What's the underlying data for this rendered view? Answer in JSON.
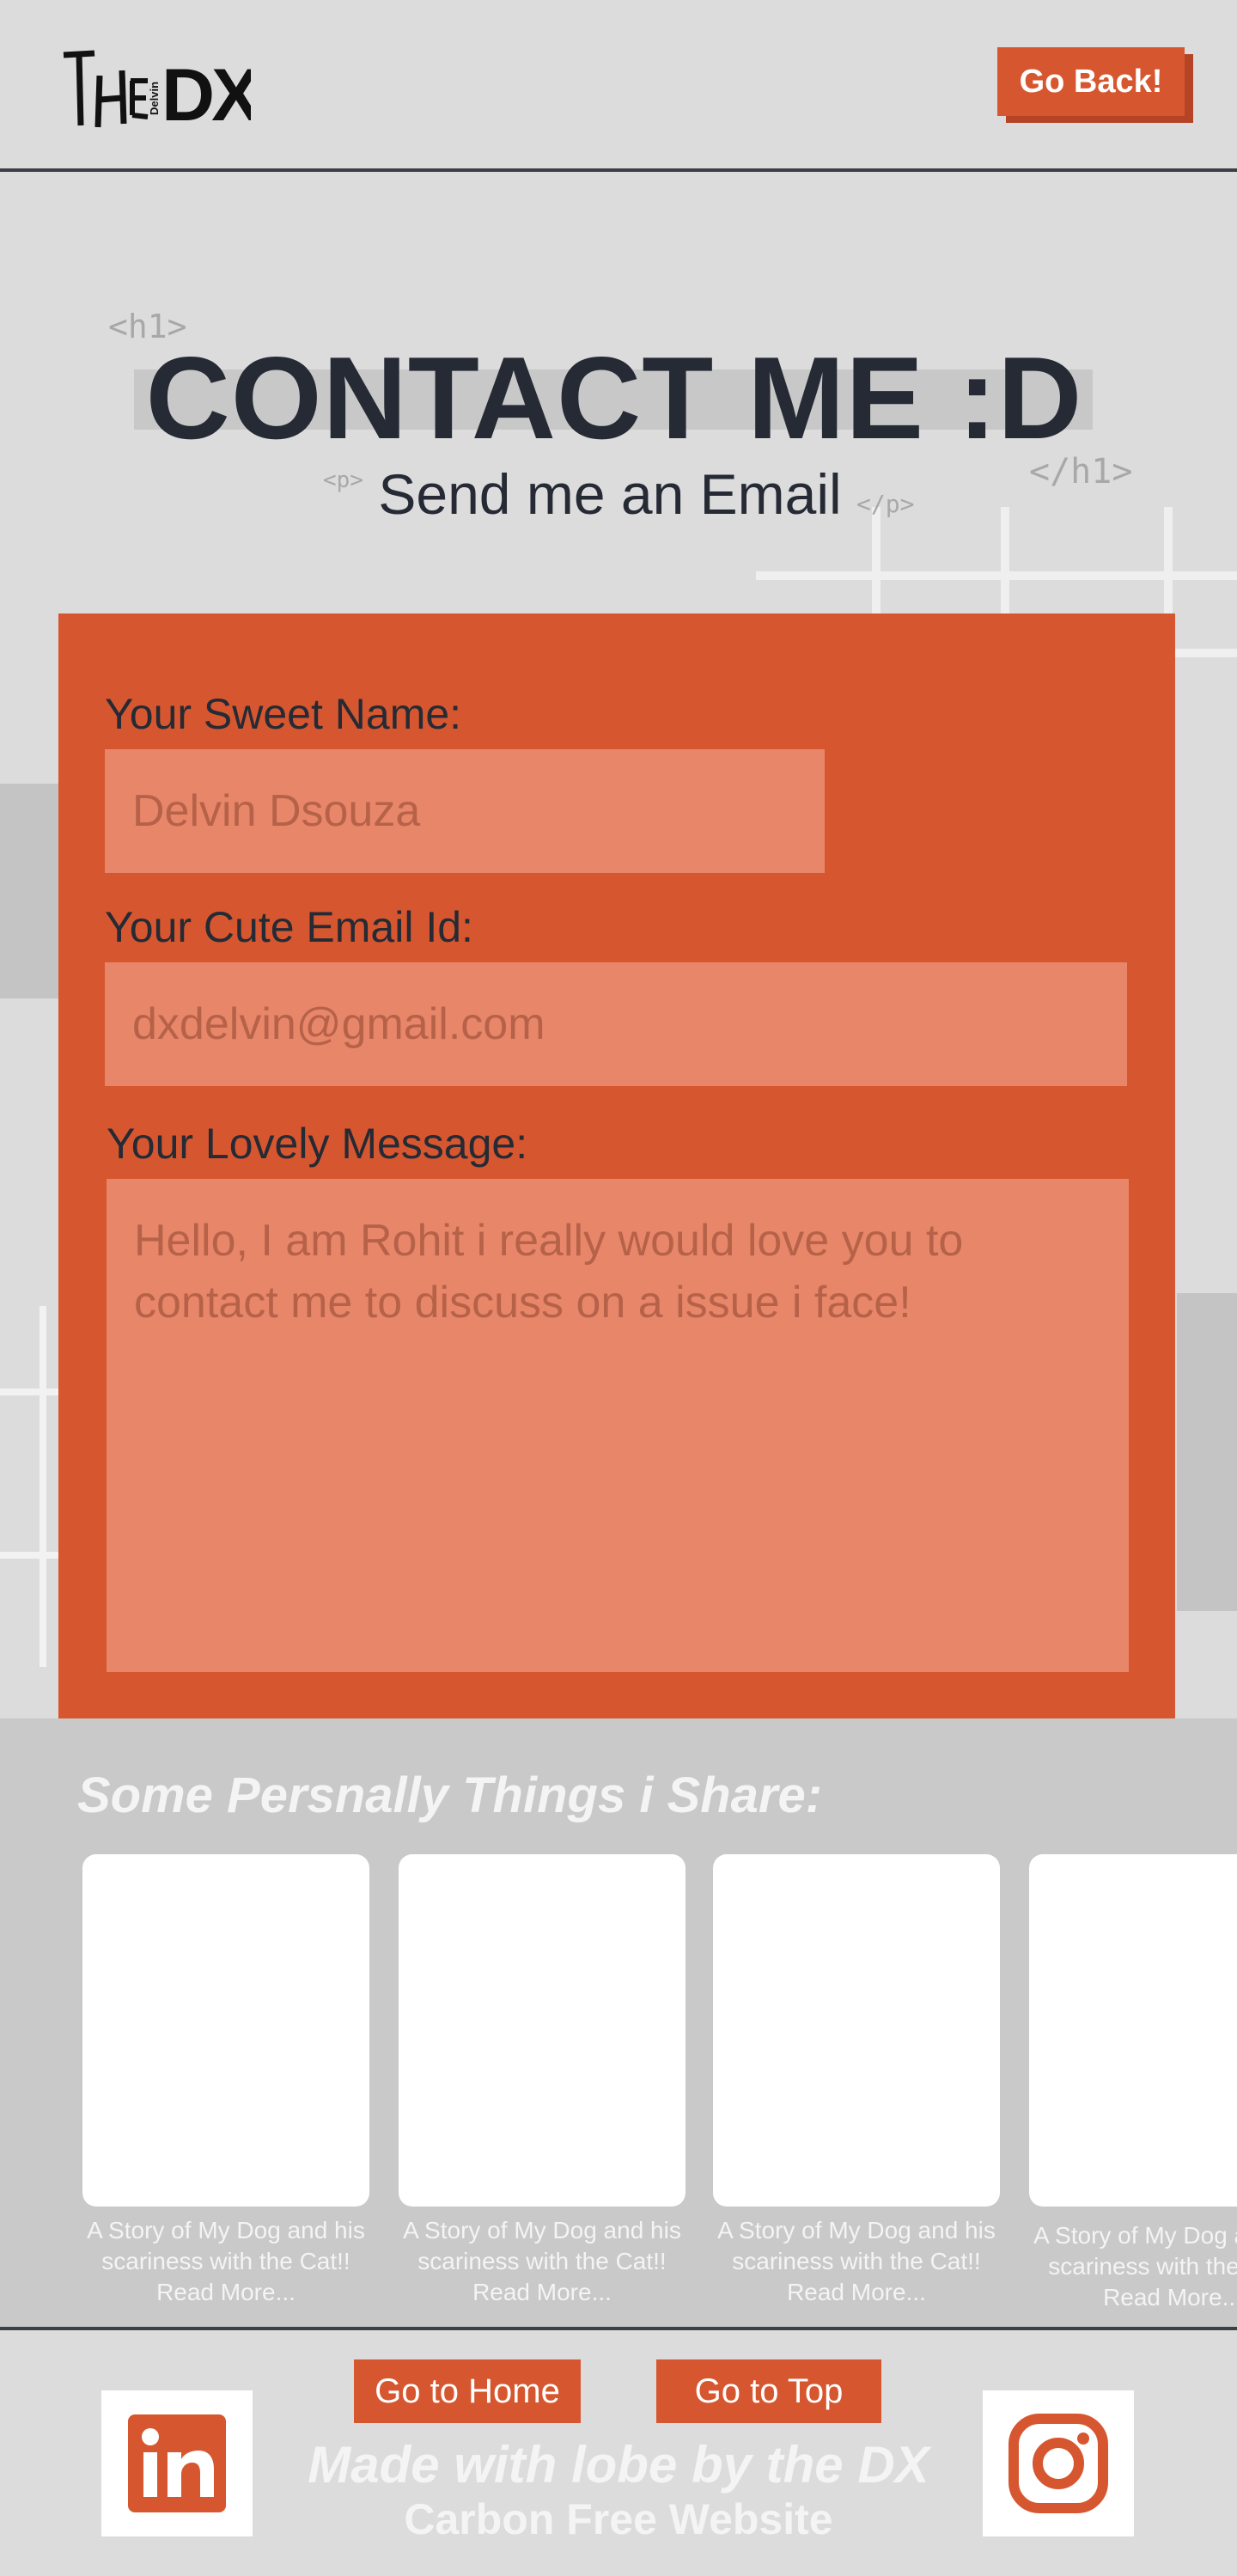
{
  "header": {
    "logo_text_the": "THE",
    "logo_text_delvin": "Delvin",
    "logo_text_dx": "DX",
    "go_back_label": "Go Back!"
  },
  "hero": {
    "tag_h1_open": "<h1>",
    "tag_h1_close": "</h1>",
    "tag_p_open": "<p>",
    "tag_p_close": "</p>",
    "title": "CONTACT ME :D",
    "subtitle": "Send me an Email"
  },
  "form": {
    "name_label": "Your Sweet Name:",
    "name_placeholder": "Delvin Dsouza",
    "email_label": "Your Cute Email Id:",
    "email_placeholder": "dxdelvin@gmail.com",
    "message_label": "Your Lovely Message:",
    "message_placeholder": "Hello, I am Rohit i really would love you to contact me to discuss on a issue i face!"
  },
  "personal": {
    "title": "Some Persnally Things i Share:",
    "stories": [
      {
        "text": "A Story of My Dog and his scariness with the Cat!! Read More..."
      },
      {
        "text": "A Story of My Dog and his scariness with the Cat!! Read More..."
      },
      {
        "text": "A Story of My Dog and his scariness with the Cat!! Read More..."
      },
      {
        "text": "A Story of My Dog and his scariness with the Cat!! Read More..."
      }
    ]
  },
  "footer": {
    "home_label": "Go to Home",
    "top_label": "Go to Top",
    "made_with": "Made with lobe by the DX",
    "carbon": "Carbon Free Website",
    "linkedin_icon": "linkedin-icon",
    "instagram_icon": "instagram-icon"
  },
  "colors": {
    "accent": "#d6572f",
    "field": "#e8866a",
    "background": "#dcdcdc",
    "text_dark": "#252a34"
  }
}
